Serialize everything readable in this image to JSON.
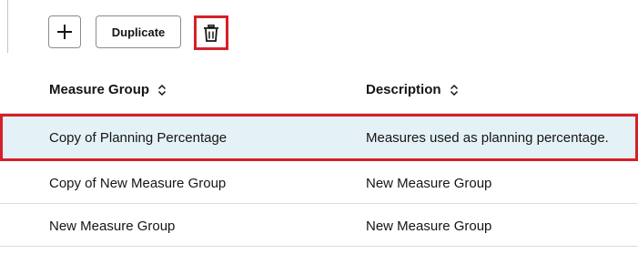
{
  "toolbar": {
    "add_icon": "plus-icon",
    "duplicate_label": "Duplicate",
    "delete_icon": "trash-icon",
    "highlight_color": "#d6202a"
  },
  "table": {
    "columns": [
      {
        "label": "Measure Group",
        "sort_icon": "sort-updown-icon"
      },
      {
        "label": "Description",
        "sort_icon": "sort-updown-icon"
      }
    ],
    "rows": [
      {
        "measure_group": "Copy of Planning Percentage",
        "description": "Measures used as planning percentage.",
        "selected": true
      },
      {
        "measure_group": "Copy of New Measure Group",
        "description": "New Measure Group",
        "selected": false
      },
      {
        "measure_group": "New Measure Group",
        "description": "New Measure Group",
        "selected": false
      }
    ],
    "selected_row_color": "#e4f1f7"
  }
}
